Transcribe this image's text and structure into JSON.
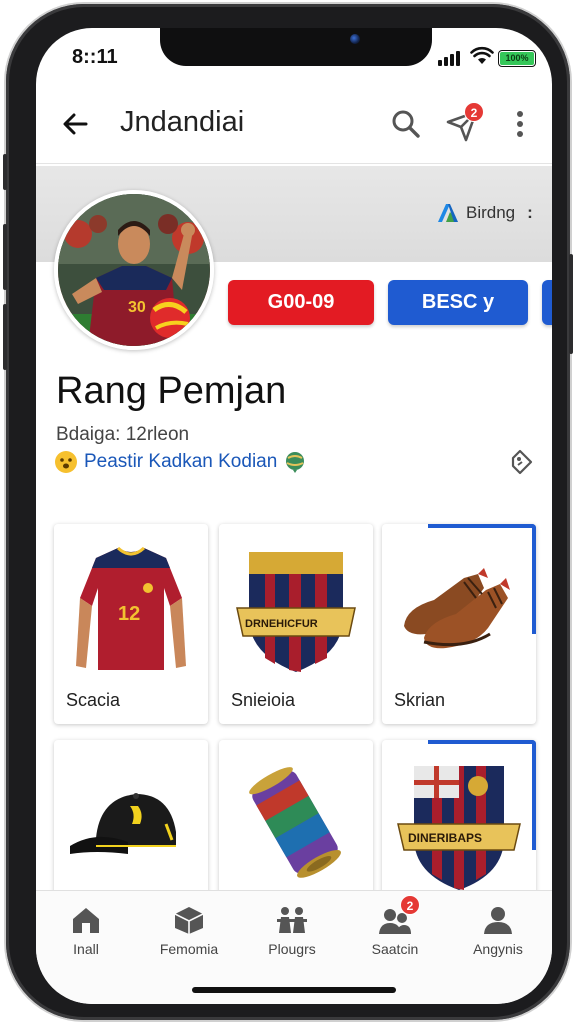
{
  "status_bar": {
    "time": "8::11",
    "battery_label": "100%"
  },
  "app_bar": {
    "title": "Jndandiai",
    "notification_count": "2"
  },
  "branding": {
    "label": "Birdng",
    "more": ":"
  },
  "actions": {
    "primary_label": "G00-09",
    "secondary_label": "BESC  y"
  },
  "profile": {
    "name": "Rang Pemjan",
    "meta": "Bdaiga: 12rleon",
    "team": "Peastir Kadkan Kodian",
    "jersey_number": "30"
  },
  "items": [
    {
      "label": "Scacia",
      "icon": "jersey-icon",
      "number": "12"
    },
    {
      "label": "Snieioia",
      "icon": "club-crest-icon",
      "text": "DRNEHICFUR"
    },
    {
      "label": "Skrian",
      "icon": "boots-icon"
    },
    {
      "label": "",
      "icon": "cap-icon"
    },
    {
      "label": "",
      "icon": "can-icon"
    },
    {
      "label": "",
      "icon": "crest-icon",
      "text": "DINERIBAPS"
    }
  ],
  "bottom_nav": [
    {
      "label": "Inall",
      "icon": "home-icon"
    },
    {
      "label": "Femomia",
      "icon": "box-icon"
    },
    {
      "label": "Plougrs",
      "icon": "players-icon"
    },
    {
      "label": "Saatcin",
      "icon": "group-icon",
      "badge": "2"
    },
    {
      "label": "Angynis",
      "icon": "profile-icon"
    }
  ],
  "colors": {
    "accent_red": "#e31b23",
    "accent_blue": "#1f5bd1",
    "badge_red": "#e53935"
  }
}
